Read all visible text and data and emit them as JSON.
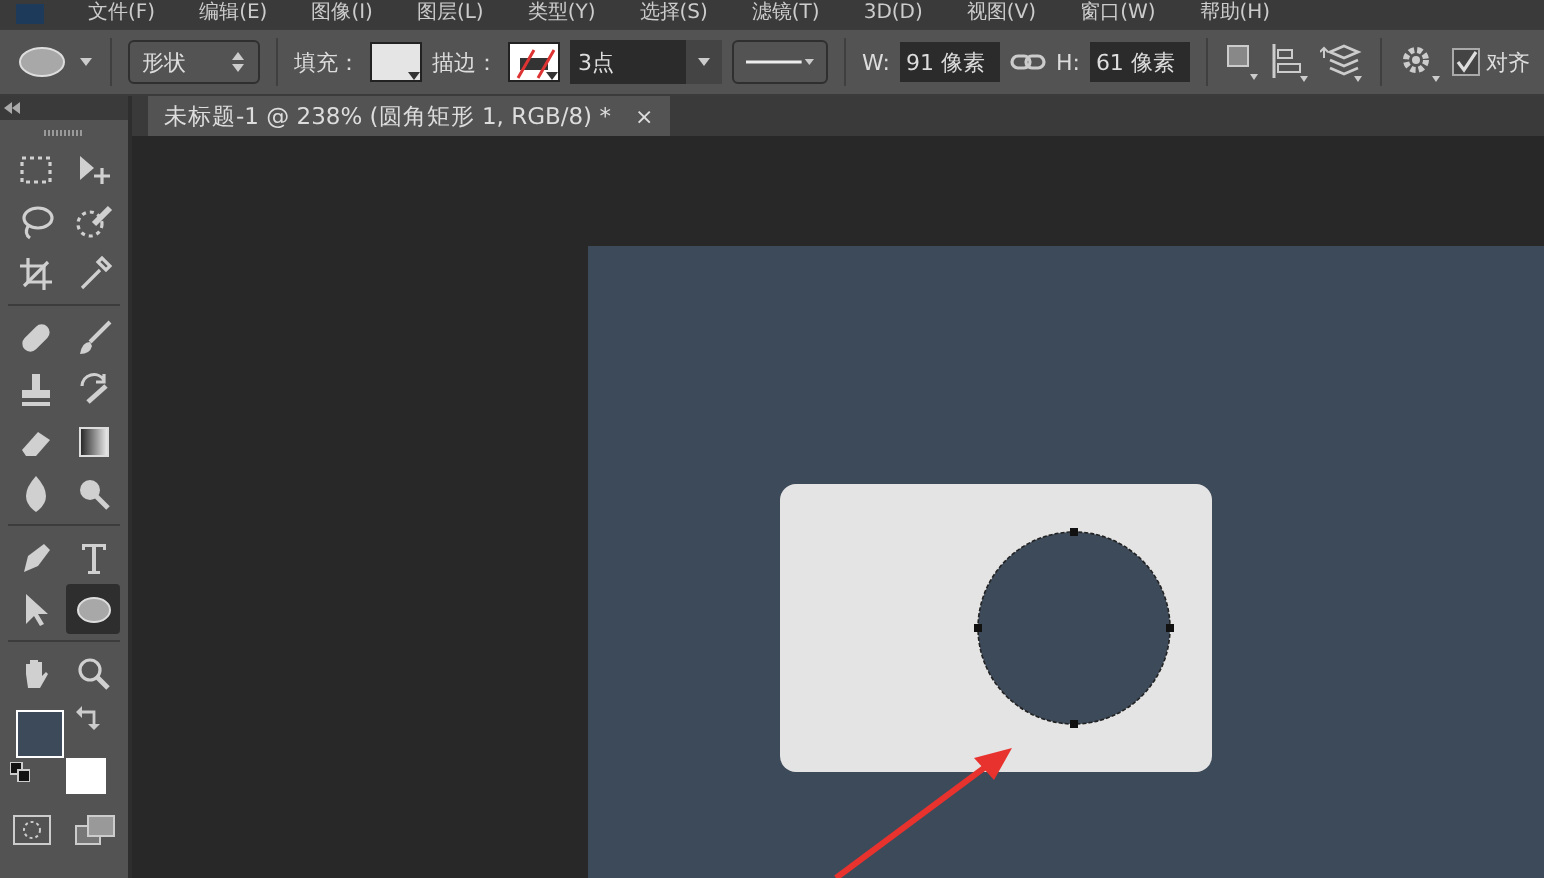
{
  "menu_bar": {
    "items": [
      "文件(F)",
      "编辑(E)",
      "图像(I)",
      "图层(L)",
      "类型(Y)",
      "选择(S)",
      "滤镜(T)",
      "3D(D)",
      "视图(V)",
      "窗口(W)",
      "帮助(H)"
    ]
  },
  "options_bar": {
    "mode": "形状",
    "fill_label": "填充：",
    "stroke_label": "描边：",
    "stroke_width": "3点",
    "w_label": "W:",
    "width": "91 像素",
    "h_label": "H:",
    "height": "61 像素",
    "align_edges": {
      "label": "对齐",
      "checked": true
    }
  },
  "document_tab": {
    "title": "未标题-1 @ 238% (圆角矩形 1, RGB/8) *",
    "close": "×",
    "selected": true
  },
  "toolbox": {
    "tools": [
      {
        "selected": false
      },
      {
        "selected": false
      },
      {
        "selected": false
      },
      {
        "selected": false
      },
      {
        "selected": false
      },
      {
        "selected": false
      },
      {
        "selected": false
      },
      {
        "selected": false
      },
      {
        "selected": false
      },
      {
        "selected": false
      },
      {
        "selected": false
      },
      {
        "selected": false
      },
      {
        "selected": false
      },
      {
        "selected": false
      },
      {
        "selected": false
      },
      {
        "selected": false
      },
      {
        "selected": false
      },
      {
        "selected": true
      },
      {
        "selected": false
      },
      {
        "selected": false
      }
    ]
  }
}
